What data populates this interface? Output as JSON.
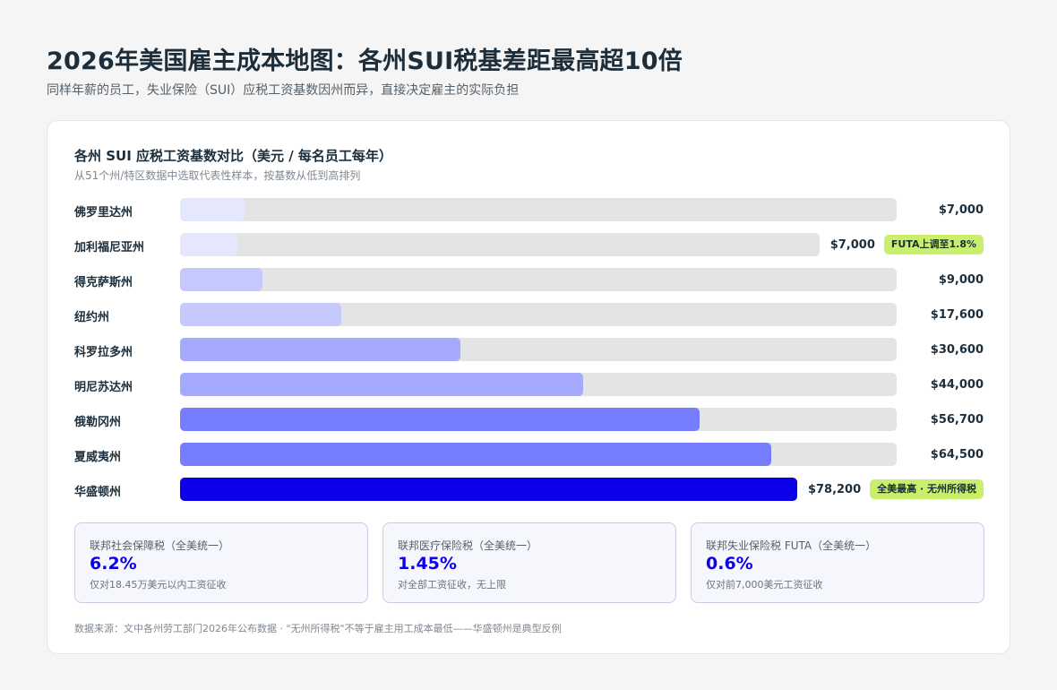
{
  "page": {
    "title": "2026年美国雇主成本地图：各州SUI税基差距最高超10倍",
    "subtitle": "同样年薪的员工，失业保险（SUI）应税工资基数因州而异，直接决定雇主的实际负担"
  },
  "card": {
    "title": "各州 SUI 应税工资基数对比（美元 / 每名员工每年）",
    "subtitle": "从51个州/特区数据中选取代表性样本，按基数从低到高排列"
  },
  "chart_data": {
    "type": "bar",
    "orientation": "horizontal",
    "title": "各州 SUI 应税工资基数对比（美元 / 每名员工每年）",
    "categories": [
      "佛罗里达州",
      "加利福尼亚州",
      "得克萨斯州",
      "纽约州",
      "科罗拉多州",
      "明尼苏达州",
      "俄勒冈州",
      "夏威夷州",
      "华盛顿州"
    ],
    "values": [
      7000,
      7000,
      9000,
      17600,
      30600,
      44000,
      56700,
      64500,
      78200
    ],
    "value_labels": [
      "$7,000",
      "$7,000",
      "$9,000",
      "$17,600",
      "$30,600",
      "$44,000",
      "$56,700",
      "$64,500",
      "$78,200"
    ],
    "xlim": [
      0,
      78200
    ],
    "bar_colors": [
      "#e5e7fd",
      "#e5e7fd",
      "#c5c9fe",
      "#c5c9fe",
      "#a5aafe",
      "#a5aafe",
      "#767dfe",
      "#767dfe",
      "#0b00e8"
    ],
    "track_color": "#e4e4e4",
    "badges": [
      {
        "category": "加利福尼亚州",
        "text": "FUTA上调至1.8%"
      },
      {
        "category": "华盛顿州",
        "text": "全美最高 · 无州所得税"
      }
    ],
    "badge_color": "#c9ef6c",
    "grid": false
  },
  "stats": [
    {
      "label": "联邦社会保障税（全美统一）",
      "value": "6.2%",
      "note": "仅对18.45万美元以内工资征收"
    },
    {
      "label": "联邦医疗保险税（全美统一）",
      "value": "1.45%",
      "note": "对全部工资征收，无上限"
    },
    {
      "label": "联邦失业保险税 FUTA（全美统一）",
      "value": "0.6%",
      "note": "仅对前7,000美元工资征收"
    }
  ],
  "footnote": "数据来源：文中各州劳工部门2026年公布数据 · \"无州所得税\"不等于雇主用工成本最低——华盛顿州是典型反例",
  "colors": {
    "accent": "#0b00e8",
    "badge": "#c9ef6c",
    "title": "#1c2e3b"
  }
}
